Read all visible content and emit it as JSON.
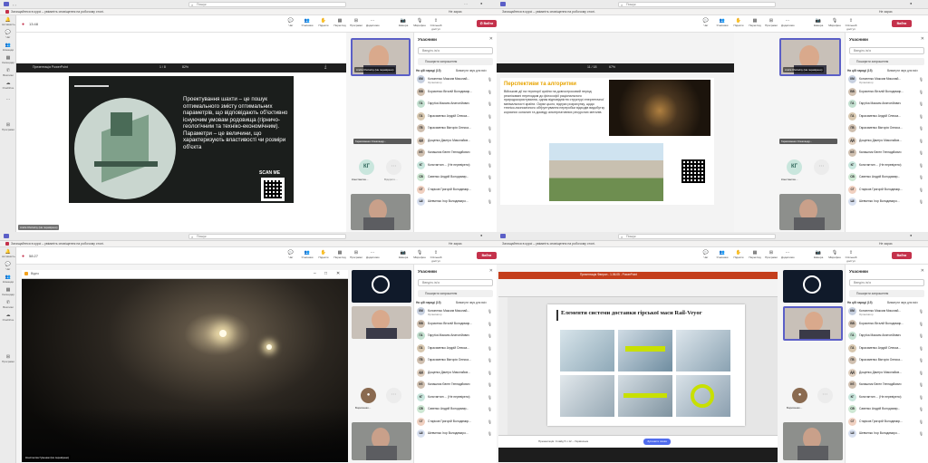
{
  "app": {
    "search_placeholder": "Пошук",
    "banner_text": "Захищайтеся в курсі – увімкніть сповіщення на робочому столі.",
    "banner_action": "Увімкнути",
    "banner_dismiss": "Не зараз"
  },
  "rail": [
    "Активність",
    "Чат",
    "Команди",
    "Календар",
    "Виклики",
    "OneDrive",
    "Програми"
  ],
  "meeting": {
    "time_tl": "13:48",
    "time_bl": "58:27",
    "buttons": [
      "Чат",
      "Учасники",
      "Підняти",
      "Перегляд",
      "Програми",
      "Додатково",
      "Камера",
      "Мікрофон",
      "Спільний доступ"
    ],
    "leave": "Вийти",
    "participants_count": "22"
  },
  "panel": {
    "title": "Учасники",
    "search": "Введіть ім'я",
    "invite": "Поширити запрошення",
    "in_meeting": "На цій нараді (15)",
    "mute_all": "Вимкнути звук для всіх",
    "people": [
      {
        "initials": "КМ",
        "name": "Кононенко Максим Миколай...",
        "role": "Організатор",
        "color": "#c8d1e0"
      },
      {
        "initials": "БВ",
        "name": "Борисенко Віталій Володимир...",
        "role": "",
        "color": "#d0c0b0"
      },
      {
        "initials": "ГА",
        "name": "Гаруґка Максим Анатолійович",
        "role": "",
        "color": "#c3e0d0"
      },
      {
        "initials": "ГА",
        "name": "Гарасименко Андрій Олекса...",
        "role": "",
        "color": "#d8c8b0"
      },
      {
        "initials": "ГВ",
        "name": "Гарасименко Вікторія Олекса...",
        "role": "",
        "color": "#d0c0b0"
      },
      {
        "initials": "ДД",
        "name": "Дощенко Дмитро Миколайов...",
        "role": "",
        "color": "#e0d0c0"
      },
      {
        "initials": "КЄ",
        "name": "Калашник Євген Геннадійович",
        "role": "",
        "color": "#d0c0b0"
      },
      {
        "initials": "КГ",
        "name": "Константин ... (Не перевірено)",
        "role": "",
        "color": "#c9e6dd"
      },
      {
        "initials": "СВ",
        "name": "Савенко Андрій Володимир...",
        "role": "",
        "color": "#cfe8d4"
      },
      {
        "initials": "СГ",
        "name": "Старіков Григорій Володимир...",
        "role": "",
        "color": "#f0d0c0"
      },
      {
        "initials": "ШІ",
        "name": "Шевченко Ігор Володимиро...",
        "role": "",
        "color": "#d8e0f0"
      }
    ]
  },
  "q1": {
    "viewer_title": "Презентація PowerPoint",
    "page_label": "1 / 8",
    "zoom": "82%",
    "slide_text": "Проектування шахти – це пошук оптимального змісту оптимальних параметрів, що відповідають об'єктивно існуючим умовам родовища (гірничо-геологічним та техніко-економічним). Параметри – це величини, що характеризують властивості чи розміри об'єкта",
    "scan_label": "SCAN ME",
    "presenter_label": "André Kholodny (Не перевірено)",
    "tile_top_label": "André Kholodny (Не перевірено)",
    "tile_mid_label": "Гарасименко Олександр...",
    "avatar_initials": "КГ",
    "avatar_name": "Константин...",
    "avatar2_name": "Відкрито..."
  },
  "q2": {
    "title": "Перспективи та алгоритми",
    "body": "Військові дії на території країни на довгостроковий період реалізовані переходом до філософії раціонального природокористування, однак відповідністю структурі енергетичної мінімальності країни. Окрім цього, відгуки розрахунку, щодо техніко-економічного обґрунтування переробки відходів видобутку корисних копалин та досвіду альтернативних ресурсних металів.",
    "page_label": "11 / 18",
    "zoom": "67%"
  },
  "q3": {
    "window_title": "Відео",
    "caption": "Константин Гуменюк (Не перевірено)",
    "avatar_name": "Борисенко..."
  },
  "q4": {
    "app_title": "Презентація Фаерон - 1.06.05 - PowerPoint",
    "slide_title": "Елементи системи доставки гірської маси Rail-Veyor",
    "status_text": "Презентація: Слайд 5 з 12 – Українська",
    "share_btn": "Зупинити показ",
    "presenter_label": "Константин... (Не перевірено)",
    "avatar_name": "Борисенко..."
  }
}
